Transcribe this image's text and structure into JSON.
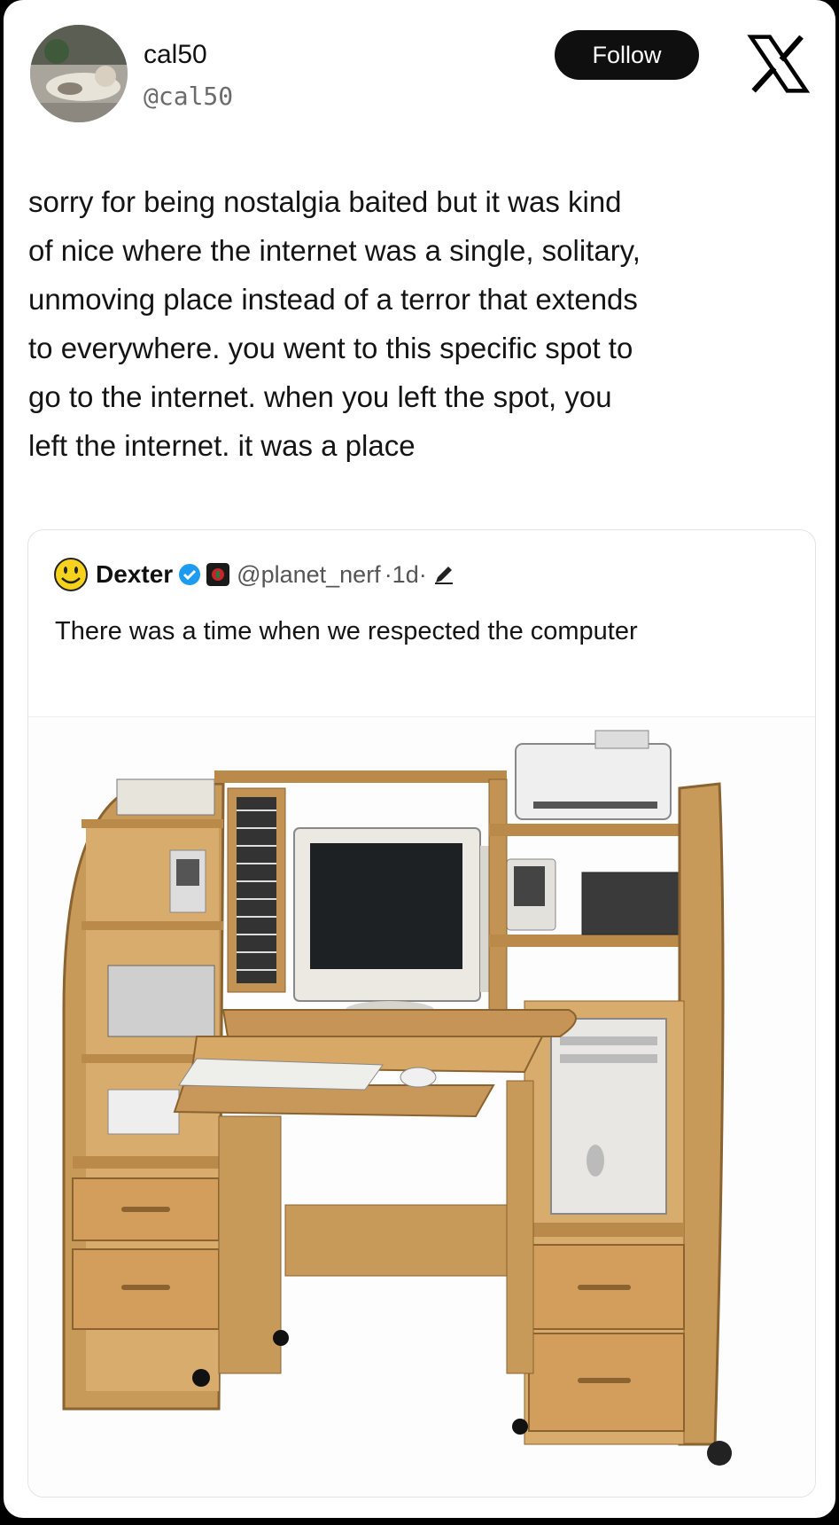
{
  "author": {
    "name": "cal50",
    "handle": "@cal50"
  },
  "follow_label": "Follow",
  "logo": "x-logo-icon",
  "tweet_text": "sorry for being nostalgia baited but it was kind\nof nice where the internet was a single, solitary,\nunmoving place instead of a terror that extends\nto everywhere. you went to this specific spot to\ngo to the internet.  when you left the spot, you\nleft the internet. it was a place",
  "quote": {
    "name": "Dexter",
    "handle": "@planet_nerf",
    "meta": "·1d·",
    "text": "There was a time when we respected the computer",
    "icons": [
      "smiley-icon",
      "verified-icon",
      "flag-icon",
      "pencil-icon"
    ]
  },
  "colors": {
    "background": "#000000",
    "card": "#ffffff",
    "follow_button": "#0f0f0f",
    "verified": "#1d9bf0",
    "wood": "#c99a5a"
  }
}
